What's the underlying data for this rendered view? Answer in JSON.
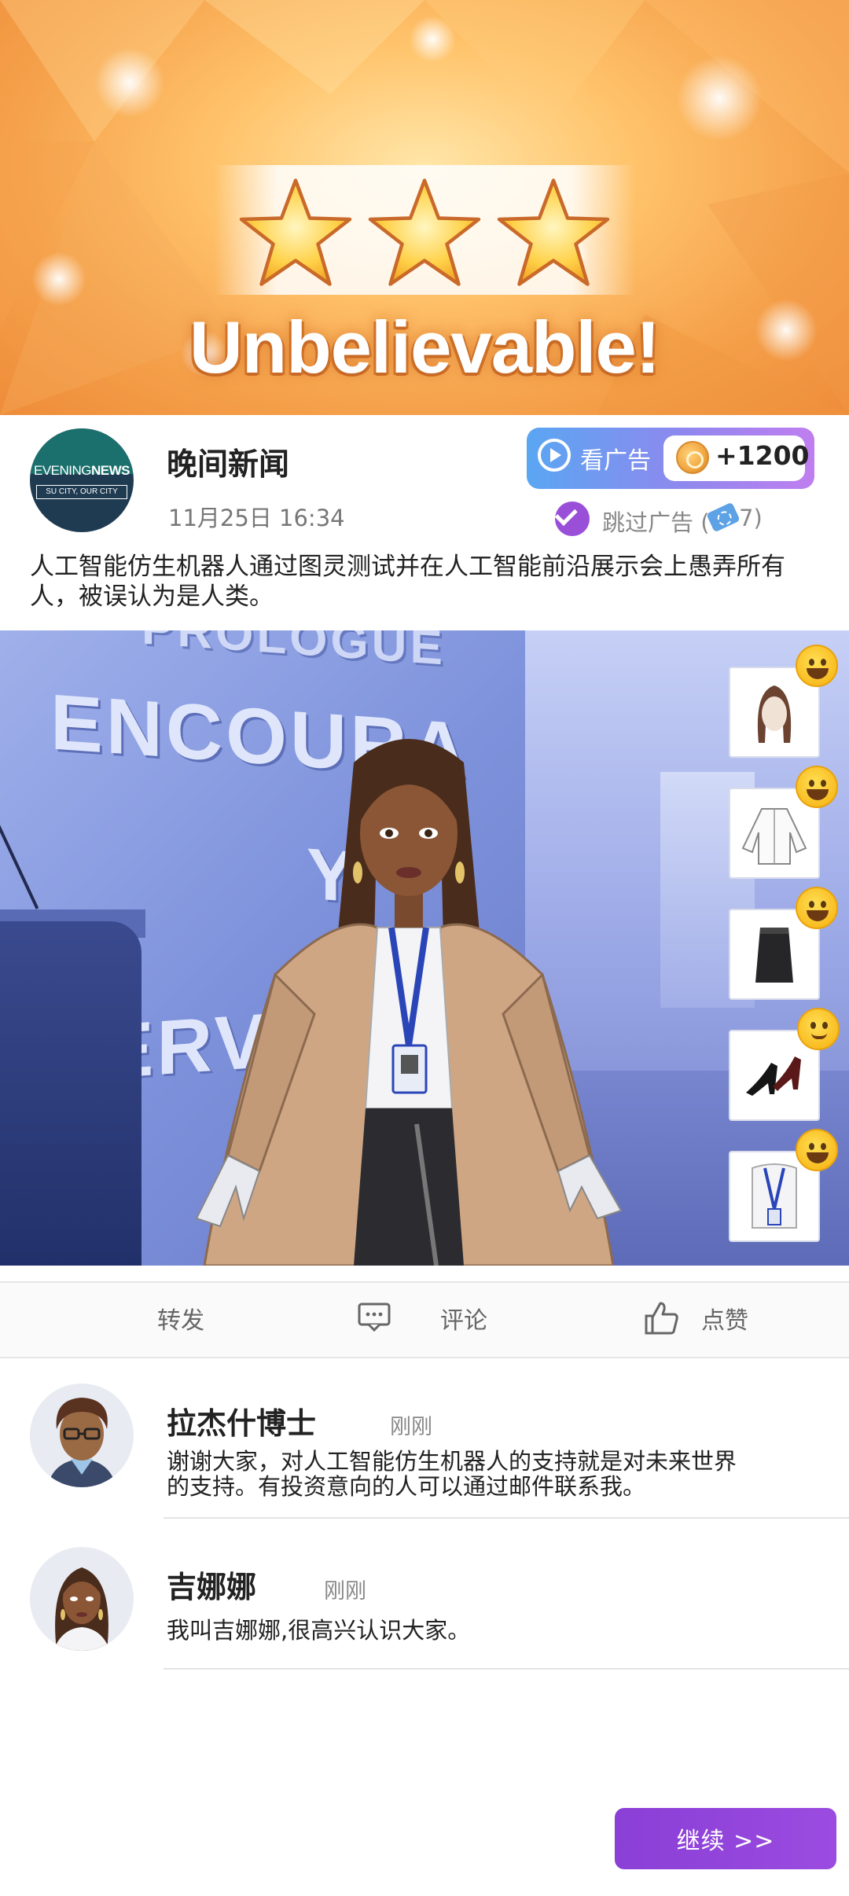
{
  "banner": {
    "headline": "Unbelievable!",
    "stars_earned": 3,
    "stars_total": 3
  },
  "post": {
    "logo": {
      "name_prefix": "EVENING",
      "name_bold": "NEWS",
      "tagline": "SU CITY, OUR CITY"
    },
    "author": "晚间新闻",
    "timestamp": "11月25日 16:34",
    "body": "人工智能仿生机器人通过图灵测试并在人工智能前沿展示会上愚弄所有人，被误认为是人类。"
  },
  "ad": {
    "watch_label": "看广告",
    "reward_amount": "+1200",
    "skip_label": "跳过广告",
    "skip_count_open": "(",
    "skip_count": "7)"
  },
  "scene": {
    "wall_text_lines": [
      "PROLOGUE",
      "ENCOURA",
      "Y",
      "ERVE"
    ],
    "outfit_slots": [
      {
        "item": "hair",
        "reaction": "grin"
      },
      {
        "item": "blouse",
        "reaction": "grin"
      },
      {
        "item": "skirt",
        "reaction": "grin"
      },
      {
        "item": "heels",
        "reaction": "smile"
      },
      {
        "item": "lanyard-badge",
        "reaction": "grin"
      }
    ]
  },
  "actions": {
    "share_label": "转发",
    "comment_label": "评论",
    "like_label": "点赞"
  },
  "comments": [
    {
      "name": "拉杰什博士",
      "time": "刚刚",
      "text_line1": "谢谢大家，对人工智能仿生机器人的支持就是对未来世界",
      "text_line2": "的支持。有投资意向的人可以通过邮件联系我。"
    },
    {
      "name": "吉娜娜",
      "time": "刚刚",
      "text_line1": "我叫吉娜娜,很高兴认识大家。"
    }
  ],
  "continue_label": "继续 >>",
  "colors": {
    "accent_purple": "#9b4be0",
    "banner_orange": "#f5a04a",
    "ad_gradient_start": "#5aa6f2",
    "ad_gradient_end": "#c07ef0"
  }
}
